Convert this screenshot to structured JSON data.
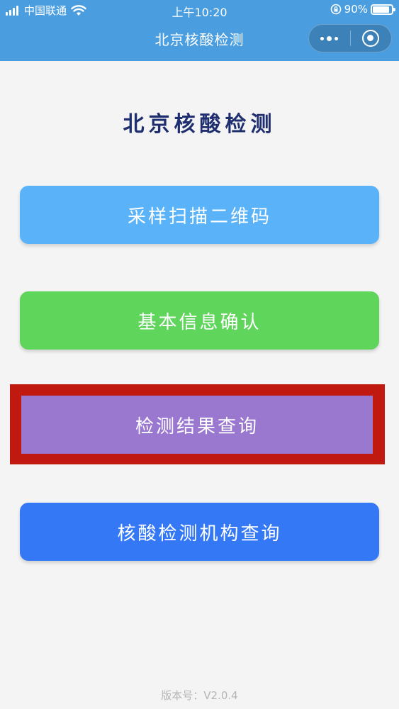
{
  "status_bar": {
    "carrier": "中国联通",
    "time": "上午10:20",
    "battery": "90%"
  },
  "nav": {
    "title": "北京核酸检测"
  },
  "page": {
    "heading": "北京核酸检测",
    "buttons": [
      {
        "label": "采样扫描二维码",
        "color": "#5ab3f8"
      },
      {
        "label": "基本信息确认",
        "color": "#60d55c"
      },
      {
        "label": "检测结果查询",
        "color": "#9a78cf"
      },
      {
        "label": "核酸检测机构查询",
        "color": "#3478f6"
      }
    ],
    "highlight_color": "#c0190f"
  },
  "footer": {
    "version": "版本号：V2.0.4"
  }
}
